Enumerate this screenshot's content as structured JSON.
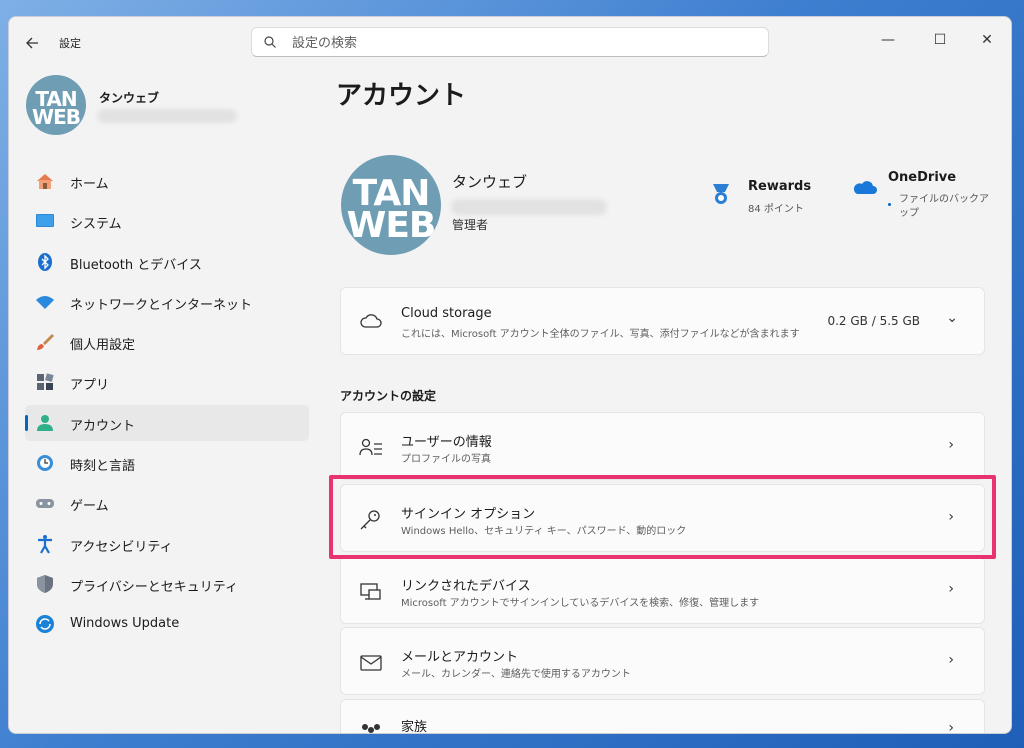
{
  "window": {
    "title": "設定"
  },
  "search": {
    "placeholder": "設定の検索"
  },
  "window_controls": {
    "minimize": "—",
    "maximize": "☐",
    "close": "✕"
  },
  "profile": {
    "avatar_text_1": "TAN",
    "avatar_text_2": "WEB",
    "name": "タンウェブ"
  },
  "sidebar": {
    "items": [
      {
        "label": "ホーム",
        "icon": "home-icon"
      },
      {
        "label": "システム",
        "icon": "system-icon"
      },
      {
        "label": "Bluetooth とデバイス",
        "icon": "bluetooth-icon"
      },
      {
        "label": "ネットワークとインターネット",
        "icon": "wifi-icon"
      },
      {
        "label": "個人用設定",
        "icon": "brush-icon"
      },
      {
        "label": "アプリ",
        "icon": "apps-icon"
      },
      {
        "label": "アカウント",
        "icon": "account-icon",
        "active": true
      },
      {
        "label": "時刻と言語",
        "icon": "clock-globe-icon"
      },
      {
        "label": "ゲーム",
        "icon": "gamepad-icon"
      },
      {
        "label": "アクセシビリティ",
        "icon": "accessibility-icon"
      },
      {
        "label": "プライバシーとセキュリティ",
        "icon": "shield-icon"
      },
      {
        "label": "Windows Update",
        "icon": "update-icon"
      }
    ]
  },
  "main": {
    "title": "アカウント",
    "hero": {
      "name": "タンウェブ",
      "role": "管理者"
    },
    "rewards": {
      "title": "Rewards",
      "points": "84 ポイント"
    },
    "onedrive": {
      "title": "OneDrive",
      "subtitle": "ファイルのバックアップ"
    },
    "cloud_storage": {
      "title": "Cloud storage",
      "description": "これには、Microsoft アカウント全体のファイル、写真、添付ファイルなどが含まれます",
      "value": "0.2 GB / 5.5 GB"
    },
    "section_heading": "アカウントの設定",
    "settings": [
      {
        "title": "ユーザーの情報",
        "description": "プロファイルの写真",
        "icon": "user-info-icon"
      },
      {
        "title": "サインイン オプション",
        "description": "Windows Hello、セキュリティ キー、パスワード、動的ロック",
        "icon": "key-icon"
      },
      {
        "title": "リンクされたデバイス",
        "description": "Microsoft アカウントでサインインしているデバイスを検索、修復、管理します",
        "icon": "devices-icon"
      },
      {
        "title": "メールとアカウント",
        "description": "メール、カレンダー、連絡先で使用するアカウント",
        "icon": "mail-icon"
      },
      {
        "title": "家族",
        "description": "",
        "icon": "family-icon"
      }
    ]
  },
  "colors": {
    "accent": "#0067c0",
    "highlight": "#e8336f",
    "avatar_bg": "#6f9eb4"
  }
}
